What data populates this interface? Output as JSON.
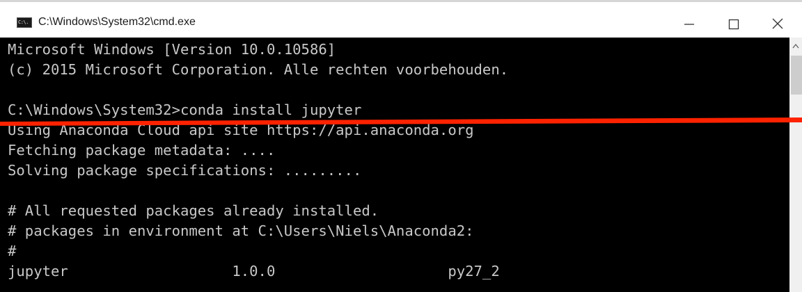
{
  "window": {
    "title": "C:\\Windows\\System32\\cmd.exe",
    "icon_glyph": "C:\\.",
    "controls": {
      "minimize": "minimize-icon",
      "maximize": "maximize-icon",
      "close": "close-icon"
    }
  },
  "console": {
    "lines": [
      "Microsoft Windows [Version 10.0.10586]",
      "(c) 2015 Microsoft Corporation. Alle rechten voorbehouden.",
      "",
      "C:\\Windows\\System32>conda install jupyter",
      "Using Anaconda Cloud api site https://api.anaconda.org",
      "Fetching package metadata: ....",
      "Solving package specifications: .........",
      "",
      "# All requested packages already installed.",
      "# packages in environment at C:\\Users\\Niels\\Anaconda2:",
      "#",
      "jupyter                   1.0.0                    py27_2"
    ]
  },
  "colors": {
    "console_background": "#000000",
    "console_text": "#c8c8c8",
    "annotation_line": "#ff2200",
    "titlebar_background": "#ffffff"
  }
}
